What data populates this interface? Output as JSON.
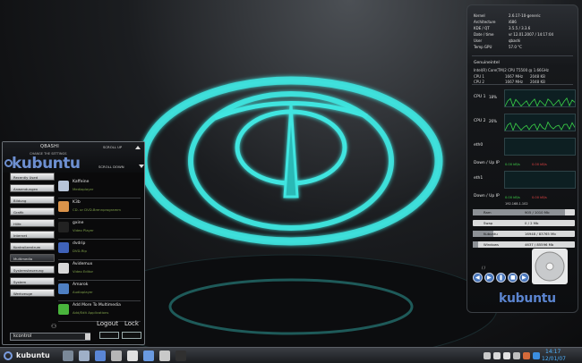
{
  "kmenu": {
    "username": "QBASHI",
    "settings_label": "CHANGE THE SETTINGS",
    "brand": "kubuntu",
    "scroll_up": "SCROLL UP",
    "scroll_down": "SCROLL DOWN",
    "categories": [
      "Recently Used",
      "Anwendungen",
      "Bildung",
      "Grafik",
      "Hilfe",
      "Internet",
      "Kontrollzentrum",
      "Multimedia",
      "Systemsteuerung",
      "System",
      "Werkzeuge"
    ],
    "active_category_index": 7,
    "apps": [
      {
        "name": "Kaffeine",
        "desc": "Mediaplayer",
        "icon": "kaffeine-icon",
        "color": "#b7c4d8"
      },
      {
        "name": "K3b",
        "desc": "CD- or DVD-Brennprogramm",
        "icon": "k3b-icon",
        "color": "#d9934a"
      },
      {
        "name": "gxine",
        "desc": "Video Player",
        "icon": "gxine-icon",
        "color": "#222222"
      },
      {
        "name": "dvdrip",
        "desc": "DVD-Rip",
        "icon": "dvdrip-icon",
        "color": "#3f62b8"
      },
      {
        "name": "Avidemux",
        "desc": "Video Editor",
        "icon": "avidemux-icon",
        "color": "#d8d8d8"
      },
      {
        "name": "Amarok",
        "desc": "Audioplayer",
        "icon": "amarok-icon",
        "color": "#4e7fc2"
      },
      {
        "name": "Add More To Multimedia",
        "desc": "Add/Edit Applications",
        "icon": "add-icon",
        "color": "#49b43c"
      }
    ],
    "logout_label": "Logout",
    "lock_label": "Lock",
    "run_value": "kcontrol"
  },
  "sysmon": {
    "info": [
      {
        "key": "Kernel",
        "value": "2.6.17-10-generic"
      },
      {
        "key": "Architecture",
        "value": "i686"
      },
      {
        "key": "KDE / QT",
        "value": "3.5.5 / 3.3.6"
      },
      {
        "key": "Date / time",
        "value": "vr 12.01.2007 / 14:17:04"
      },
      {
        "key": "User",
        "value": "qbashi"
      },
      {
        "key": "Temp GPU",
        "value": "57.0 °C"
      }
    ],
    "cpu_title": "Genuineintel",
    "cpu_model": "Intel(R) Core(TM)2 CPU         T5500  @ 1.66GHz",
    "cpus": [
      {
        "name": "CPU 1",
        "freq": "1667 MHz",
        "cache": "2048 KB"
      },
      {
        "name": "CPU 2",
        "freq": "1667 MHz",
        "cache": "2048 KB"
      }
    ],
    "graphs": [
      {
        "label": "CPU 1",
        "pct": "18%"
      },
      {
        "label": "CPU 2",
        "pct": "26%"
      },
      {
        "label": "eth0",
        "pct": ""
      },
      {
        "label": "Down / Up IP",
        "pct": ""
      },
      {
        "label": "eth1",
        "pct": ""
      },
      {
        "label": "Down / Up IP",
        "pct": ""
      }
    ],
    "eth0_down": "0.00 kB/s",
    "eth0_up": "0.00 kB/s",
    "eth1_down": "0.00 kB/s",
    "eth1_up": "0.00 kB/s",
    "ip": "192.168.1.102",
    "memory": [
      {
        "name": "Ram",
        "value": "905 / 1010 Mb",
        "fill": 0.9
      },
      {
        "name": "Swap",
        "value": "0 / 2 Mb",
        "fill": 0.0
      },
      {
        "name": "Kubuntu",
        "value": "16948 / 83765 Mb",
        "fill": 0.2
      },
      {
        "name": "Windows",
        "value": "4637 / 85596 Mb",
        "fill": 0.05
      }
    ],
    "track": "/ /",
    "brand": "kubuntu"
  },
  "taskbar": {
    "kmenu_label": "kubuntu",
    "clock_time": "14:17",
    "clock_date": "12/01/07",
    "launchers": [
      {
        "icon": "desktop-icon",
        "color": "#7a8898"
      },
      {
        "icon": "home-folder-icon",
        "color": "#9fb0c8"
      },
      {
        "icon": "konqueror-icon",
        "color": "#5a86d6"
      },
      {
        "icon": "settings-icon",
        "color": "#b6b6b6"
      },
      {
        "icon": "kmail-icon",
        "color": "#e0e0e0"
      },
      {
        "icon": "network-icon",
        "color": "#6a9ae0"
      },
      {
        "icon": "printer-icon",
        "color": "#c9c9c9"
      },
      {
        "icon": "terminal-icon",
        "color": "#303030"
      }
    ],
    "tray": [
      {
        "icon": "clipboard-icon",
        "color": "#c9c9c9"
      },
      {
        "icon": "volume-icon",
        "color": "#d9d9d9"
      },
      {
        "icon": "wifi-icon",
        "color": "#e2e2e2"
      },
      {
        "icon": "battery-icon",
        "color": "#bfbfbf"
      },
      {
        "icon": "update-icon",
        "color": "#d46a3a"
      },
      {
        "icon": "power-icon",
        "color": "#3b8ee0"
      }
    ]
  }
}
